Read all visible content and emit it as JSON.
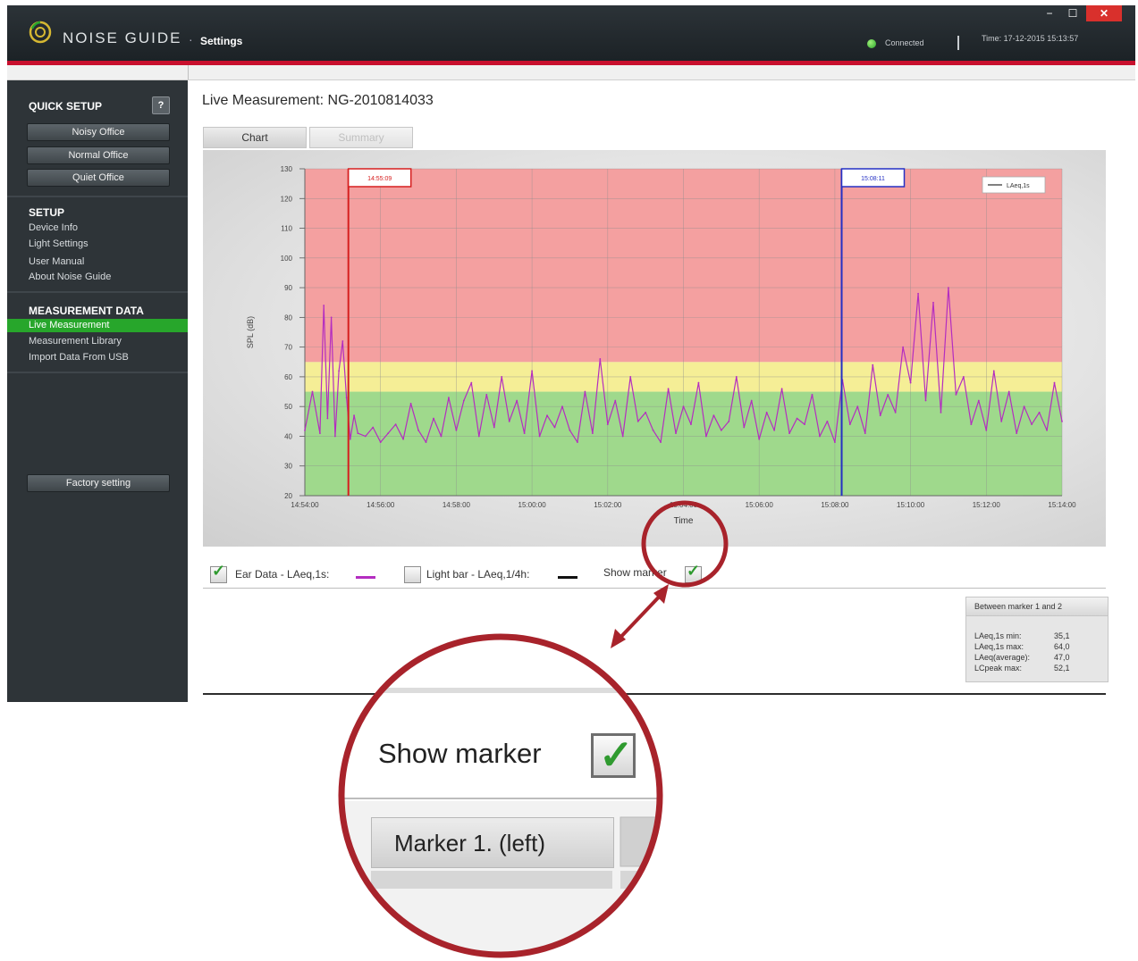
{
  "window": {
    "app_name": "NOISE GUIDE",
    "separator": "·",
    "section": "Settings",
    "status": "Connected",
    "time": "Time: 17-12-2015 15:13:57",
    "min_glyph": "−",
    "max_glyph": "☐",
    "close_glyph": "✕"
  },
  "sidebar": {
    "quick_setup_title": "QUICK SETUP",
    "help_label": "?",
    "quick_buttons": [
      "Noisy Office",
      "Normal Office",
      "Quiet Office"
    ],
    "setup_title": "SETUP",
    "setup_items": [
      "Device Info",
      "Light Settings",
      "User Manual",
      "About Noise Guide"
    ],
    "measurement_title": "MEASUREMENT DATA",
    "measurement_items": [
      "Live Measurement",
      "Measurement Library",
      "Import Data From USB"
    ],
    "factory_button": "Factory setting"
  },
  "main": {
    "title": "Live Measurement: NG-2010814033",
    "tabs": [
      "Chart",
      "Summary"
    ],
    "legend": {
      "ear_data": "Ear Data - LAeq,1s:",
      "light_bar": "Light bar - LAeq,1/4h:",
      "show_marker": "Show marker"
    }
  },
  "chart_data": {
    "type": "line",
    "ylabel": "SPL (dB)",
    "xlabel": "Time",
    "ylim": [
      20,
      130
    ],
    "yticks": [
      "20",
      "30",
      "40",
      "50",
      "60",
      "70",
      "80",
      "90",
      "100",
      "110",
      "120",
      "130"
    ],
    "xticks": [
      "14:54:00",
      "14:56:00",
      "14:58:00",
      "15:00:00",
      "15:02:00",
      "15:04:00",
      "15:06:00",
      "15:08:00",
      "15:10:00",
      "15:12:00",
      "15:14:00"
    ],
    "zones": [
      {
        "from": 20,
        "to": 55,
        "color": "#9fd98c"
      },
      {
        "from": 55,
        "to": 65,
        "color": "#f5ee96"
      },
      {
        "from": 65,
        "to": 130,
        "color": "#f4a0a0"
      }
    ],
    "series": [
      {
        "name": "LAeq,1s",
        "color": "#b42dc0",
        "x_minutes": [
          0,
          0.2,
          0.4,
          0.5,
          0.6,
          0.7,
          0.8,
          0.9,
          1.0,
          1.1,
          1.2,
          1.3,
          1.4,
          1.6,
          1.8,
          2.0,
          2.2,
          2.4,
          2.6,
          2.8,
          3.0,
          3.2,
          3.4,
          3.6,
          3.8,
          4.0,
          4.2,
          4.4,
          4.6,
          4.8,
          5.0,
          5.2,
          5.4,
          5.6,
          5.8,
          6.0,
          6.2,
          6.4,
          6.6,
          6.8,
          7.0,
          7.2,
          7.4,
          7.6,
          7.8,
          8.0,
          8.2,
          8.4,
          8.6,
          8.8,
          9.0,
          9.2,
          9.4,
          9.6,
          9.8,
          10.0,
          10.2,
          10.4,
          10.6,
          10.8,
          11.0,
          11.2,
          11.4,
          11.6,
          11.8,
          12.0,
          12.2,
          12.4,
          12.6,
          12.8,
          13.0,
          13.2,
          13.4,
          13.6,
          13.8,
          14.0,
          14.2,
          14.4,
          14.6,
          14.8,
          15.0,
          15.2,
          15.4,
          15.6,
          15.8,
          16.0,
          16.2,
          16.4,
          16.6,
          16.8,
          17.0,
          17.2,
          17.4,
          17.6,
          17.8,
          18.0,
          18.2,
          18.4,
          18.6,
          18.8,
          19.0,
          19.2,
          19.4,
          19.6,
          19.8,
          20.0
        ],
        "values": [
          42,
          55,
          41,
          84,
          46,
          80,
          40,
          62,
          72,
          53,
          39,
          47,
          41,
          40,
          43,
          38,
          41,
          44,
          39,
          51,
          42,
          38,
          46,
          40,
          53,
          42,
          52,
          58,
          40,
          54,
          43,
          60,
          45,
          52,
          41,
          62,
          40,
          47,
          43,
          50,
          42,
          38,
          55,
          41,
          66,
          44,
          52,
          40,
          60,
          45,
          48,
          42,
          38,
          56,
          41,
          50,
          44,
          58,
          40,
          47,
          42,
          45,
          60,
          43,
          52,
          39,
          48,
          42,
          56,
          41,
          46,
          44,
          54,
          40,
          45,
          38,
          59,
          44,
          50,
          41,
          64,
          47,
          54,
          48,
          70,
          58,
          88,
          52,
          85,
          48,
          90,
          54,
          60,
          44,
          52,
          42,
          62,
          45,
          55,
          41,
          50,
          44,
          48,
          42,
          58,
          45,
          54,
          42,
          56,
          50
        ]
      },
      {
        "name": "Light bar - LAeq,1/4h",
        "color": "#111111",
        "values": []
      }
    ],
    "markers": [
      {
        "label": "14:55:09",
        "x_minutes": 1.15,
        "color": "#d61f1f"
      },
      {
        "label": "15:08:11",
        "x_minutes": 14.18,
        "color": "#2430c4"
      }
    ],
    "legend_position": "top-right",
    "legend_label": "LAeq,1s",
    "grid": true
  },
  "stats": {
    "title": "Between marker 1 and 2",
    "rows": [
      {
        "label": "LAeq,1s min:",
        "value": "35,1"
      },
      {
        "label": "LAeq,1s max:",
        "value": "64,0"
      },
      {
        "label": "LAeq(average):",
        "value": "47,0"
      },
      {
        "label": "LCpeak max:",
        "value": "52,1"
      }
    ]
  },
  "callout": {
    "show_marker": "Show marker",
    "marker_label": "Marker 1. (left)"
  },
  "colors": {
    "accent_red": "#c8102e",
    "active_green": "#27a62b",
    "sidebar_bg": "#2e3438",
    "callout_red": "#a8232b"
  }
}
